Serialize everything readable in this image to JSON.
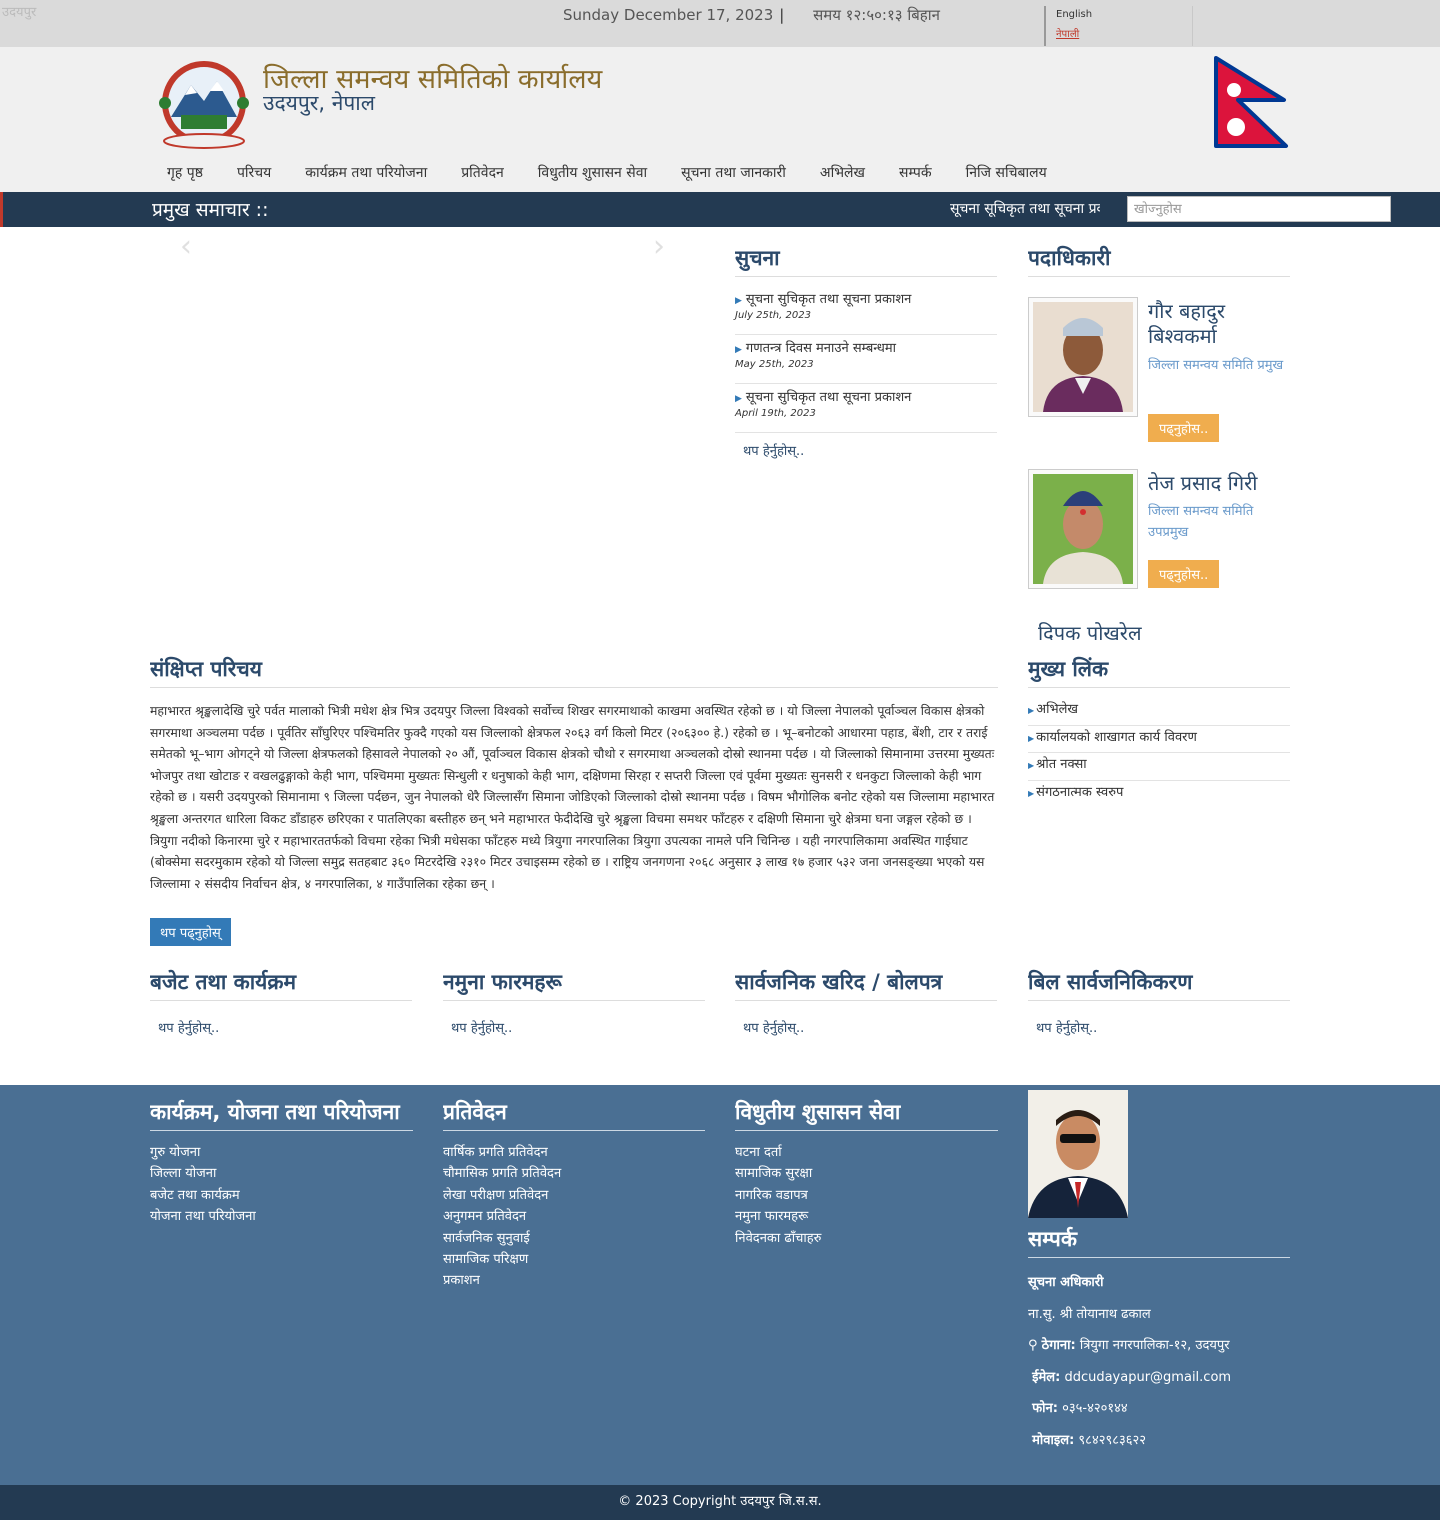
{
  "topbar": {
    "broken_image_alt": "उदयपुर",
    "date": "Sunday December 17, 2023",
    "date_sep": "|",
    "time": "समय १२:५०:१३ बिहान",
    "lang_english": "English",
    "lang_nepali": "नेपाली"
  },
  "header": {
    "title": "जिल्ला समन्वय समितिको कार्यालय",
    "subtitle": "उदयपुर, नेपाल"
  },
  "nav": {
    "items": [
      "गृह पृष्ठ",
      "परिचय",
      "कार्यक्रम तथा परियोजना",
      "प्रतिवेदन",
      "विधुतीय शुसासन सेवा",
      "सूचना तथा जानकारी",
      "अभिलेख",
      "सम्पर्क",
      "निजि सचिबालय"
    ]
  },
  "newsbar": {
    "title": "प्रमुख समाचार ::",
    "ticker": "सूचना सूचिकृत तथा सूचना प्रकाशन",
    "search_placeholder": "खोज्नुहोस"
  },
  "slider": {
    "prev": "‹",
    "next": "›"
  },
  "notices": {
    "heading": "सुचना",
    "items": [
      {
        "title": "सूचना सुचिकृत तथा सूचना प्रकाशन",
        "date": "July 25th, 2023"
      },
      {
        "title": "गणतन्त्र दिवस मनाउने सम्बन्धमा",
        "date": "May 25th, 2023"
      },
      {
        "title": "सूचना सुचिकृत तथा सूचना प्रकाशन",
        "date": "April 19th, 2023"
      }
    ],
    "more": "थप हेर्नुहोस्.."
  },
  "officials": {
    "heading": "पदाधिकारी",
    "items": [
      {
        "name": "गौर बहादुर बिश्वकर्मा",
        "role": "जिल्ला समन्वय समिति प्रमुख",
        "button": "पढ्नुहोस.."
      },
      {
        "name": "तेज प्रसाद गिरी",
        "role": "जिल्ला समन्वय समिति उपप्रमुख",
        "button": "पढ्नुहोस.."
      }
    ],
    "partial_name": "दिपक पोखरेल"
  },
  "intro": {
    "heading": "संक्षिप्त परिचय",
    "text": "महाभारत श्रृङ्खलादेखि चुरे पर्वत मालाको भित्री मधेश क्षेत्र भित्र उदयपुर जिल्ला विश्वको सर्वोच्च शिखर सगरमाथाको काखमा अवस्थित रहेको छ । यो जिल्ला नेपालको पूर्वाञ्चल विकास क्षेत्रको सगरमाथा अञ्चलमा पर्दछ । पूर्वतिर साँघुरिएर पश्चिमतिर फुक्दै गएको यस जिल्लाको क्षेत्रफल २०६३ वर्ग किलो मिटर (२०६३०० हे.) रहेको छ । भू–बनोटको आधारमा पहाड, बेंशी, टार र तराई समेतको भू–भाग ओगट्ने यो जिल्ला क्षेत्रफलको हिसावले नेपालको २० औं, पूर्वाञ्चल विकास क्षेत्रको चौथो र सगरमाथा अञ्चलको दोस्रो स्थानमा पर्दछ । यो जिल्लाको सिमानामा उत्तरमा मुख्यतः भोजपुर तथा खोटाङ र वखलढुङ्गाको केही भाग, पश्चिममा मुख्यतः सिन्धुली र धनुषाको केही भाग, दक्षिणमा सिरहा र सप्तरी जिल्ला एवं पूर्वमा मुख्यतः सुनसरी र धनकुटा जिल्लाको केही भाग रहेको छ । यसरी उदयपुरको सिमानामा ९ जिल्ला पर्दछन, जुन नेपालको धेरै जिल्लासँग सिमाना जोडिएको जिल्लाको दोस्रो स्थानमा पर्दछ । विषम भौगोलिक बनोट रहेको यस जिल्लामा महाभारत श्रृङ्खला अन्तरगत धारिला विकट डाँडाहरु छरिएका र पातलिएका बस्तीहरु छन् भने महाभारत फेदीदेखि चुरे श्रृङ्खला विचमा समथर फाँटहरु र दक्षिणी सिमाना चुरे क्षेत्रमा घना जङ्गल रहेको छ । त्रियुगा नदीको किनारमा चुरे र महाभारततर्फको विचमा रहेका भित्री मधेसका फाँटहरु मध्ये त्रियुगा नगरपालिका त्रियुगा उपत्यका नामले पनि चिनिन्छ । यही नगरपालिकामा अवस्थित गाईघाट (बोक्सेमा सदरमुकाम रहेको यो जिल्ला समुद्र सतहबाट ३६० मिटरदेखि २३१० मिटर उचाइसम्म रहेको छ । राष्ट्रिय जनगणना २०६८ अनुसार ३ लाख १७ हजार ५३२ जना जनसङ्ख्या भएको यस जिल्लामा २ संसदीय निर्वाचन क्षेत्र, ४ नगरपालिका, ४ गाउँपालिका रहेका छन् ।",
    "button": "थप पढ्नुहोस्"
  },
  "mainlinks": {
    "heading": "मुख्य लिंक",
    "items": [
      "अभिलेख",
      "कार्यालयको शाखागत कार्य विवरण",
      "श्रोत नक्सा",
      "संगठनात्मक स्वरुप"
    ]
  },
  "sections": {
    "budget": {
      "heading": "बजेट तथा कार्यक्रम",
      "more": "थप हेर्नुहोस्.."
    },
    "forms": {
      "heading": "नमुना फारमहरू",
      "more": "थप हेर्नुहोस्.."
    },
    "procurement": {
      "heading": "सार्वजनिक खरिद / बोलपत्र",
      "more": "थप हेर्नुहोस्.."
    },
    "bills": {
      "heading": "बिल सार्वजनिकिकरण",
      "more": "थप हेर्नुहोस्.."
    }
  },
  "footer": {
    "programs": {
      "heading": "कार्यक्रम, योजना तथा परियोजना",
      "items": [
        "गुरु योजना",
        "जिल्ला योजना",
        "बजेट तथा कार्यक्रम",
        "योजना तथा परियोजना"
      ]
    },
    "reports": {
      "heading": "प्रतिवेदन",
      "items": [
        "वार्षिक प्रगति प्रतिवेदन",
        "चौमासिक प्रगति प्रतिवेदन",
        "लेखा परीक्षण प्रतिवेदन",
        "अनुगमन प्रतिवेदन",
        "सार्वजनिक सुनुवाई",
        "सामाजिक परिक्षण",
        "प्रकाशन"
      ]
    },
    "egov": {
      "heading": "विधुतीय शुसासन सेवा",
      "items": [
        "घटना दर्ता",
        "सामाजिक सुरक्षा",
        "नागरिक वडापत्र",
        "नमुना फारमहरू",
        "निवेदनका ढाँचाहरु"
      ]
    },
    "contact": {
      "heading": "सम्पर्क",
      "officer_label": "सूचना अधिकारी",
      "officer_name": "ना.सु. श्री तोयानाथ ढकाल",
      "address_label": "ठेगाना:",
      "address": "त्रियुगा नगरपालिका-१२, उदयपुर",
      "email_label": "ईमेल:",
      "email": "ddcudayapur@gmail.com",
      "phone_label": "फोन:",
      "phone": "०३५-४२०१४४",
      "mobile_label": "मोवाइल:",
      "mobile": "९८४२९८३६२२"
    },
    "copyright": "© 2023 Copyright उदयपुर जि.स.स."
  },
  "colors": {
    "navy": "#233a52",
    "footer_blue": "#4a6f93",
    "gold": "#8a6d2c",
    "orange_button": "#f0ad4e",
    "blue_button": "#337ab7"
  }
}
